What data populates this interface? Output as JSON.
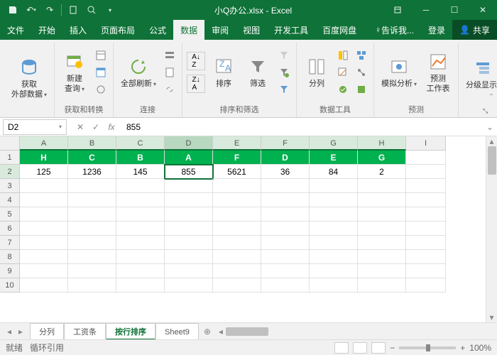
{
  "title": "小Q办公.xlsx - Excel",
  "menu": [
    "文件",
    "开始",
    "插入",
    "页面布局",
    "公式",
    "数据",
    "审阅",
    "视图",
    "开发工具",
    "百度网盘"
  ],
  "menu_active": 5,
  "tell_me": "告诉我...",
  "login": "登录",
  "share": "共享",
  "ribbon": {
    "g1": {
      "label": "获取\n外部数据",
      "btn": "获取\n外部数据"
    },
    "g2": {
      "label": "获取和转换",
      "btn": "新建\n查询"
    },
    "g3": {
      "label": "连接",
      "btn": "全部刷新"
    },
    "g4": {
      "label": "排序和筛选",
      "sort": "排序",
      "filter": "筛选"
    },
    "g5": {
      "label": "数据工具",
      "btn": "分列"
    },
    "g6": {
      "label": "预测",
      "btn1": "模拟分析",
      "btn2": "预测\n工作表"
    },
    "g7": {
      "label": "",
      "btn": "分级显示"
    }
  },
  "namebox": "D2",
  "formula": "855",
  "cols": [
    "A",
    "B",
    "C",
    "D",
    "E",
    "F",
    "G",
    "H",
    "I"
  ],
  "rows": [
    "1",
    "2",
    "3",
    "4",
    "5",
    "6",
    "7",
    "8",
    "9",
    "10"
  ],
  "data": {
    "r1": [
      "H",
      "C",
      "B",
      "A",
      "F",
      "D",
      "E",
      "G",
      ""
    ],
    "r2": [
      "125",
      "1236",
      "145",
      "855",
      "5621",
      "36",
      "84",
      "2",
      ""
    ]
  },
  "active_cell": {
    "row": 1,
    "col": 3
  },
  "sheets": [
    "分列",
    "工资条",
    "按行排序",
    "Sheet9"
  ],
  "active_sheet": 2,
  "status": {
    "ready": "就绪",
    "mode": "循环引用"
  },
  "zoom": "100%",
  "chart_data": {
    "type": "table",
    "categories": [
      "H",
      "C",
      "B",
      "A",
      "F",
      "D",
      "E",
      "G"
    ],
    "values": [
      125,
      1236,
      145,
      855,
      5621,
      36,
      84,
      2
    ]
  }
}
